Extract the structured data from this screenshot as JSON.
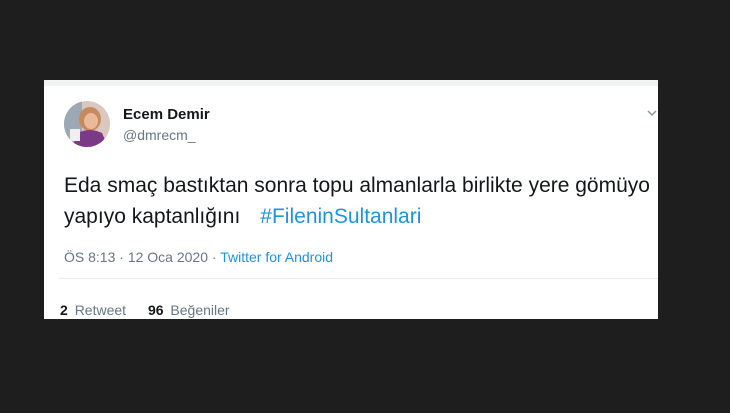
{
  "tweet": {
    "author": {
      "display_name": "Ecem Demir",
      "handle": "@dmrecm_"
    },
    "text": "Eda smaç bastıktan sonra topu almanlarla birlikte yere gömüyo yapıyo kaptanlığını",
    "hashtag": "#FileninSultanlari",
    "time": "ÖS 8:13",
    "date": "12 Oca 2020",
    "source": "Twitter for Android",
    "retweets": {
      "count": "2",
      "label": "Retweet"
    },
    "likes": {
      "count": "96",
      "label": "Beğeniler"
    }
  },
  "colors": {
    "background": "#1e1e1e",
    "card": "#ffffff",
    "link": "#1b95e0",
    "muted": "#657786",
    "text": "#14171a"
  },
  "icons": {
    "menu": "chevron-down-icon",
    "avatar": "avatar"
  }
}
